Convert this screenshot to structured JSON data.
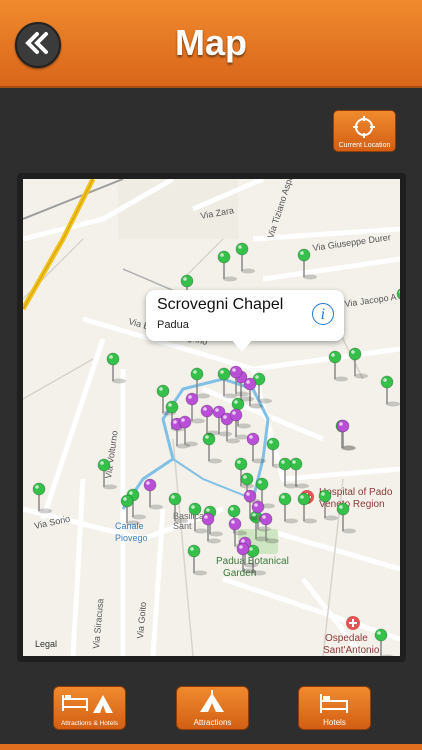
{
  "header": {
    "title": "Map"
  },
  "current_location": {
    "label": "Current Location"
  },
  "map": {
    "street_labels": [
      "Via Zara",
      "Via Tiziano Aspetti",
      "Via Giuseppe Durer",
      "Via Jacopo A",
      "Via Beato Pellegrino",
      "Via Volturno",
      "Via Sorio",
      "Via Siracusa",
      "Via Goito",
      "Legal"
    ],
    "poi_labels": [
      "Hospital of Pado",
      "Veneto Region",
      "Padua Botanical",
      "Garden",
      "Ospedale",
      "Sant'Antonio",
      "Canale",
      "Piovego",
      "Basilica",
      "Sant"
    ],
    "callout": {
      "title": "Scrovegni Chapel",
      "subtitle": "Padua",
      "info_symbol": "i"
    }
  },
  "bottom_bar": {
    "buttons": [
      {
        "label": "Attractions & Hotels"
      },
      {
        "label": "Attractions"
      },
      {
        "label": "Hotels"
      }
    ]
  },
  "colors": {
    "accent": "#e8781f",
    "pin_green": "#35c04a",
    "pin_purple": "#b84fd6",
    "route_yellow": "#f2c21b"
  }
}
